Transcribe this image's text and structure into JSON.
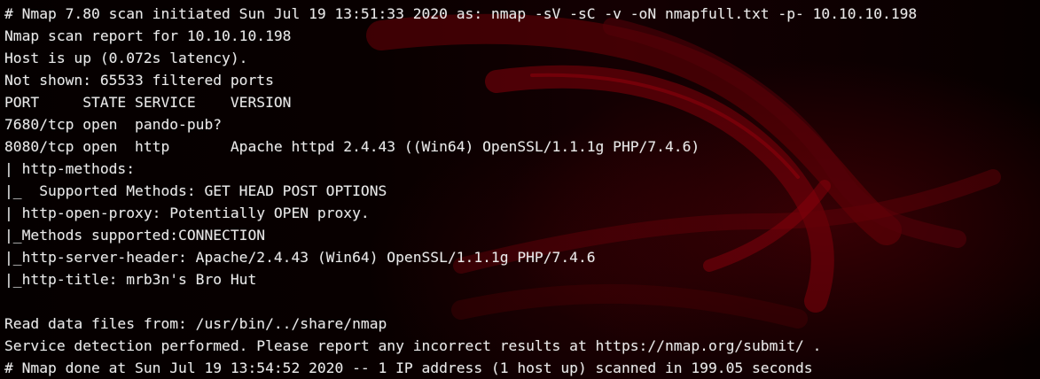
{
  "window": {
    "background_accent": "#8b0000",
    "text_color": "#e9e9e9"
  },
  "terminal": {
    "lines": [
      "# Nmap 7.80 scan initiated Sun Jul 19 13:51:33 2020 as: nmap -sV -sC -v -oN nmapfull.txt -p- 10.10.10.198",
      "Nmap scan report for 10.10.10.198",
      "Host is up (0.072s latency).",
      "Not shown: 65533 filtered ports",
      "PORT     STATE SERVICE    VERSION",
      "7680/tcp open  pando-pub?",
      "8080/tcp open  http       Apache httpd 2.4.43 ((Win64) OpenSSL/1.1.1g PHP/7.4.6)",
      "| http-methods:",
      "|_  Supported Methods: GET HEAD POST OPTIONS",
      "| http-open-proxy: Potentially OPEN proxy.",
      "|_Methods supported:CONNECTION",
      "|_http-server-header: Apache/2.4.43 (Win64) OpenSSL/1.1.1g PHP/7.4.6",
      "|_http-title: mrb3n's Bro Hut",
      "",
      "Read data files from: /usr/bin/../share/nmap",
      "Service detection performed. Please report any incorrect results at https://nmap.org/submit/ .",
      "# Nmap done at Sun Jul 19 13:54:52 2020 -- 1 IP address (1 host up) scanned in 199.05 seconds"
    ]
  }
}
